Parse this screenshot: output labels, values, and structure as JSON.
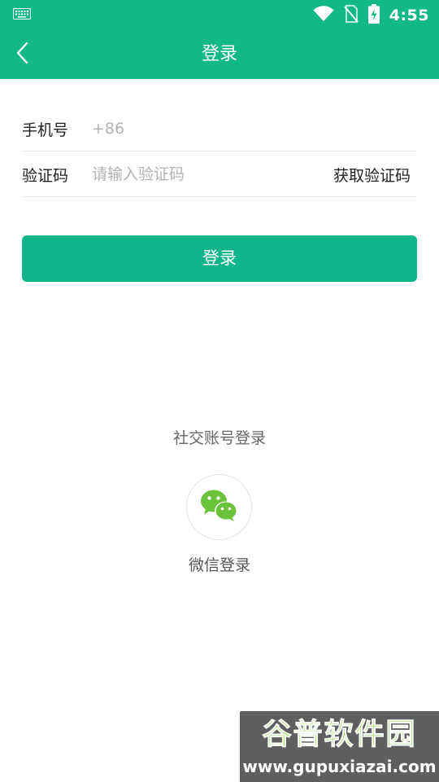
{
  "status_bar": {
    "time": "4:55",
    "icons": [
      "keyboard-icon",
      "wifi-icon",
      "no-sim-icon",
      "battery-charging-icon"
    ]
  },
  "app_bar": {
    "back_icon": "chevron-left-icon",
    "title": "登录"
  },
  "form": {
    "phone": {
      "label": "手机号",
      "placeholder": "+86",
      "value": ""
    },
    "code": {
      "label": "验证码",
      "placeholder": "请输入验证码",
      "value": "",
      "get_code_label": "获取验证码"
    },
    "submit_label": "登录"
  },
  "social": {
    "title": "社交账号登录",
    "wechat_label": "微信登录",
    "wechat_icon": "wechat-icon"
  },
  "watermark": {
    "title": "谷普软件园",
    "url": "www.gupuxiazai.com"
  },
  "colors": {
    "primary": "#12b886",
    "button": "#0fb488",
    "wechat": "#6ac33b"
  }
}
